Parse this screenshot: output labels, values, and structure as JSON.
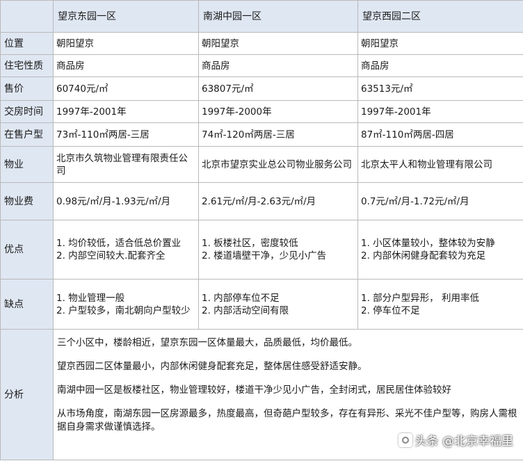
{
  "columns": [
    "望京东园一区",
    "南湖中园一区",
    "望京西园二区"
  ],
  "rows": [
    {
      "label": "位置",
      "values": [
        "朝阳望京",
        "朝阳望京",
        "朝阳望京"
      ]
    },
    {
      "label": "住宅性质",
      "values": [
        "商品房",
        "商品房",
        "商品房"
      ]
    },
    {
      "label": "售价",
      "values": [
        "60740元/㎡",
        "63807元/㎡",
        "63513元/㎡"
      ]
    },
    {
      "label": "交房时间",
      "values": [
        "1997年-2001年",
        "1997年-2000年",
        "1997年-2001年"
      ]
    },
    {
      "label": "在售户型",
      "values": [
        "73㎡-110㎡两居-三居",
        "74㎡-120㎡两居-三居",
        "87㎡-110㎡两居-四居"
      ]
    },
    {
      "label": "物业",
      "values": [
        "北京市久筑物业管理有限责任公司",
        "北京市望京实业总公司物业服务公司",
        "北京太平人和物业管理有限公司"
      ]
    },
    {
      "label": "物业费",
      "values": [
        "0.98元/㎡/月-1.93元/㎡/月",
        "2.61元/㎡/月-2.63元/㎡/月",
        "0.7元/㎡/月-1.72元/㎡/月"
      ]
    }
  ],
  "pros": {
    "label": "优点",
    "values": [
      [
        "1. 均价较低，适合低总价置业",
        "2. 内部空间较大.配套齐全"
      ],
      [
        "1. 板楼社区，密度较低",
        "2. 楼道墙壁干净，少见小广告"
      ],
      [
        "1. 小区体量较小，整体较为安静",
        "2. 内部休闲健身配套较为充足"
      ]
    ]
  },
  "cons": {
    "label": "缺点",
    "values": [
      [
        "1. 物业管理一般",
        "2. 户型较多，南北朝向户型较少"
      ],
      [
        "1. 内部停车位不足",
        "2. 内部活动空间有限"
      ],
      [
        "1. 部分户型异形， 利用率低",
        "2. 停车位不足"
      ]
    ]
  },
  "analysis": {
    "label": "分析",
    "paragraphs": [
      "三个小区中，楼龄相近，望京东园一区体量最大，品质最低，均价最低。",
      "望京西园二区体量最小，内部休闲健身配套充足，整体居住感受舒适安静。",
      "南湖中园一区是板楼社区，物业管理较好，楼道干净少见小广告，全封闭式，居民居住体验较好",
      "从市场角度，南湖东园一区房源最多，热度最高，但奇葩户型较多，存在有异形、采光不佳户型等，购房人需根据自身需求做谨慎选择。"
    ]
  },
  "watermark": "头条 @北京幸福里"
}
